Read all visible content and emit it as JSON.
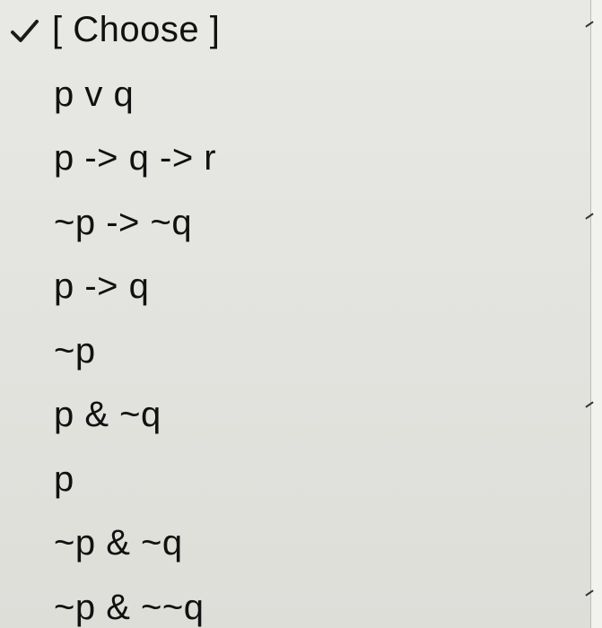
{
  "dropdown": {
    "selected_index": 0,
    "items": [
      {
        "label": "[ Choose ]"
      },
      {
        "label": "p v q"
      },
      {
        "label": "p -> q -> r"
      },
      {
        "label": "~p -> ~q"
      },
      {
        "label": "p -> q"
      },
      {
        "label": "~p"
      },
      {
        "label": "p & ~q"
      },
      {
        "label": "p"
      },
      {
        "label": "~p & ~q"
      },
      {
        "label": "~p & ~~q"
      }
    ]
  }
}
